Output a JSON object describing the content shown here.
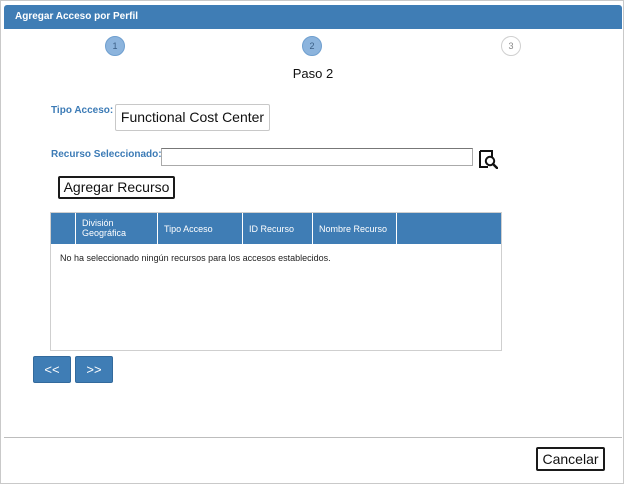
{
  "dialog": {
    "title": "Agregar Acceso por Perfil"
  },
  "steps": [
    {
      "number": "1",
      "state": "completed"
    },
    {
      "number": "2",
      "state": "current"
    },
    {
      "number": "3",
      "state": "pending"
    }
  ],
  "step_title": "Paso 2",
  "form": {
    "tipo_acceso_label": "Tipo Acceso:",
    "tipo_acceso_value": "Functional Cost Center",
    "recurso_label": "Recurso Seleccionado:",
    "recurso_value": "",
    "lookup_icon": "magnifier-lookup-icon",
    "add_button_label": "Agregar Recurso"
  },
  "grid": {
    "columns": [
      {
        "label": ""
      },
      {
        "label": "División Geográfica"
      },
      {
        "label": "Tipo Acceso"
      },
      {
        "label": "ID Recurso"
      },
      {
        "label": "Nombre Recurso"
      },
      {
        "label": ""
      }
    ],
    "rows": [],
    "empty_message": "No ha seleccionado ningún recursos para los accesos establecidos."
  },
  "navigation": {
    "prev_label": "<<",
    "next_label": ">>"
  },
  "footer": {
    "cancel_label": "Cancelar"
  },
  "colors": {
    "accent": "#3f7db5",
    "step_active": "#8cb4dd",
    "label_text": "#3c7bb6"
  }
}
